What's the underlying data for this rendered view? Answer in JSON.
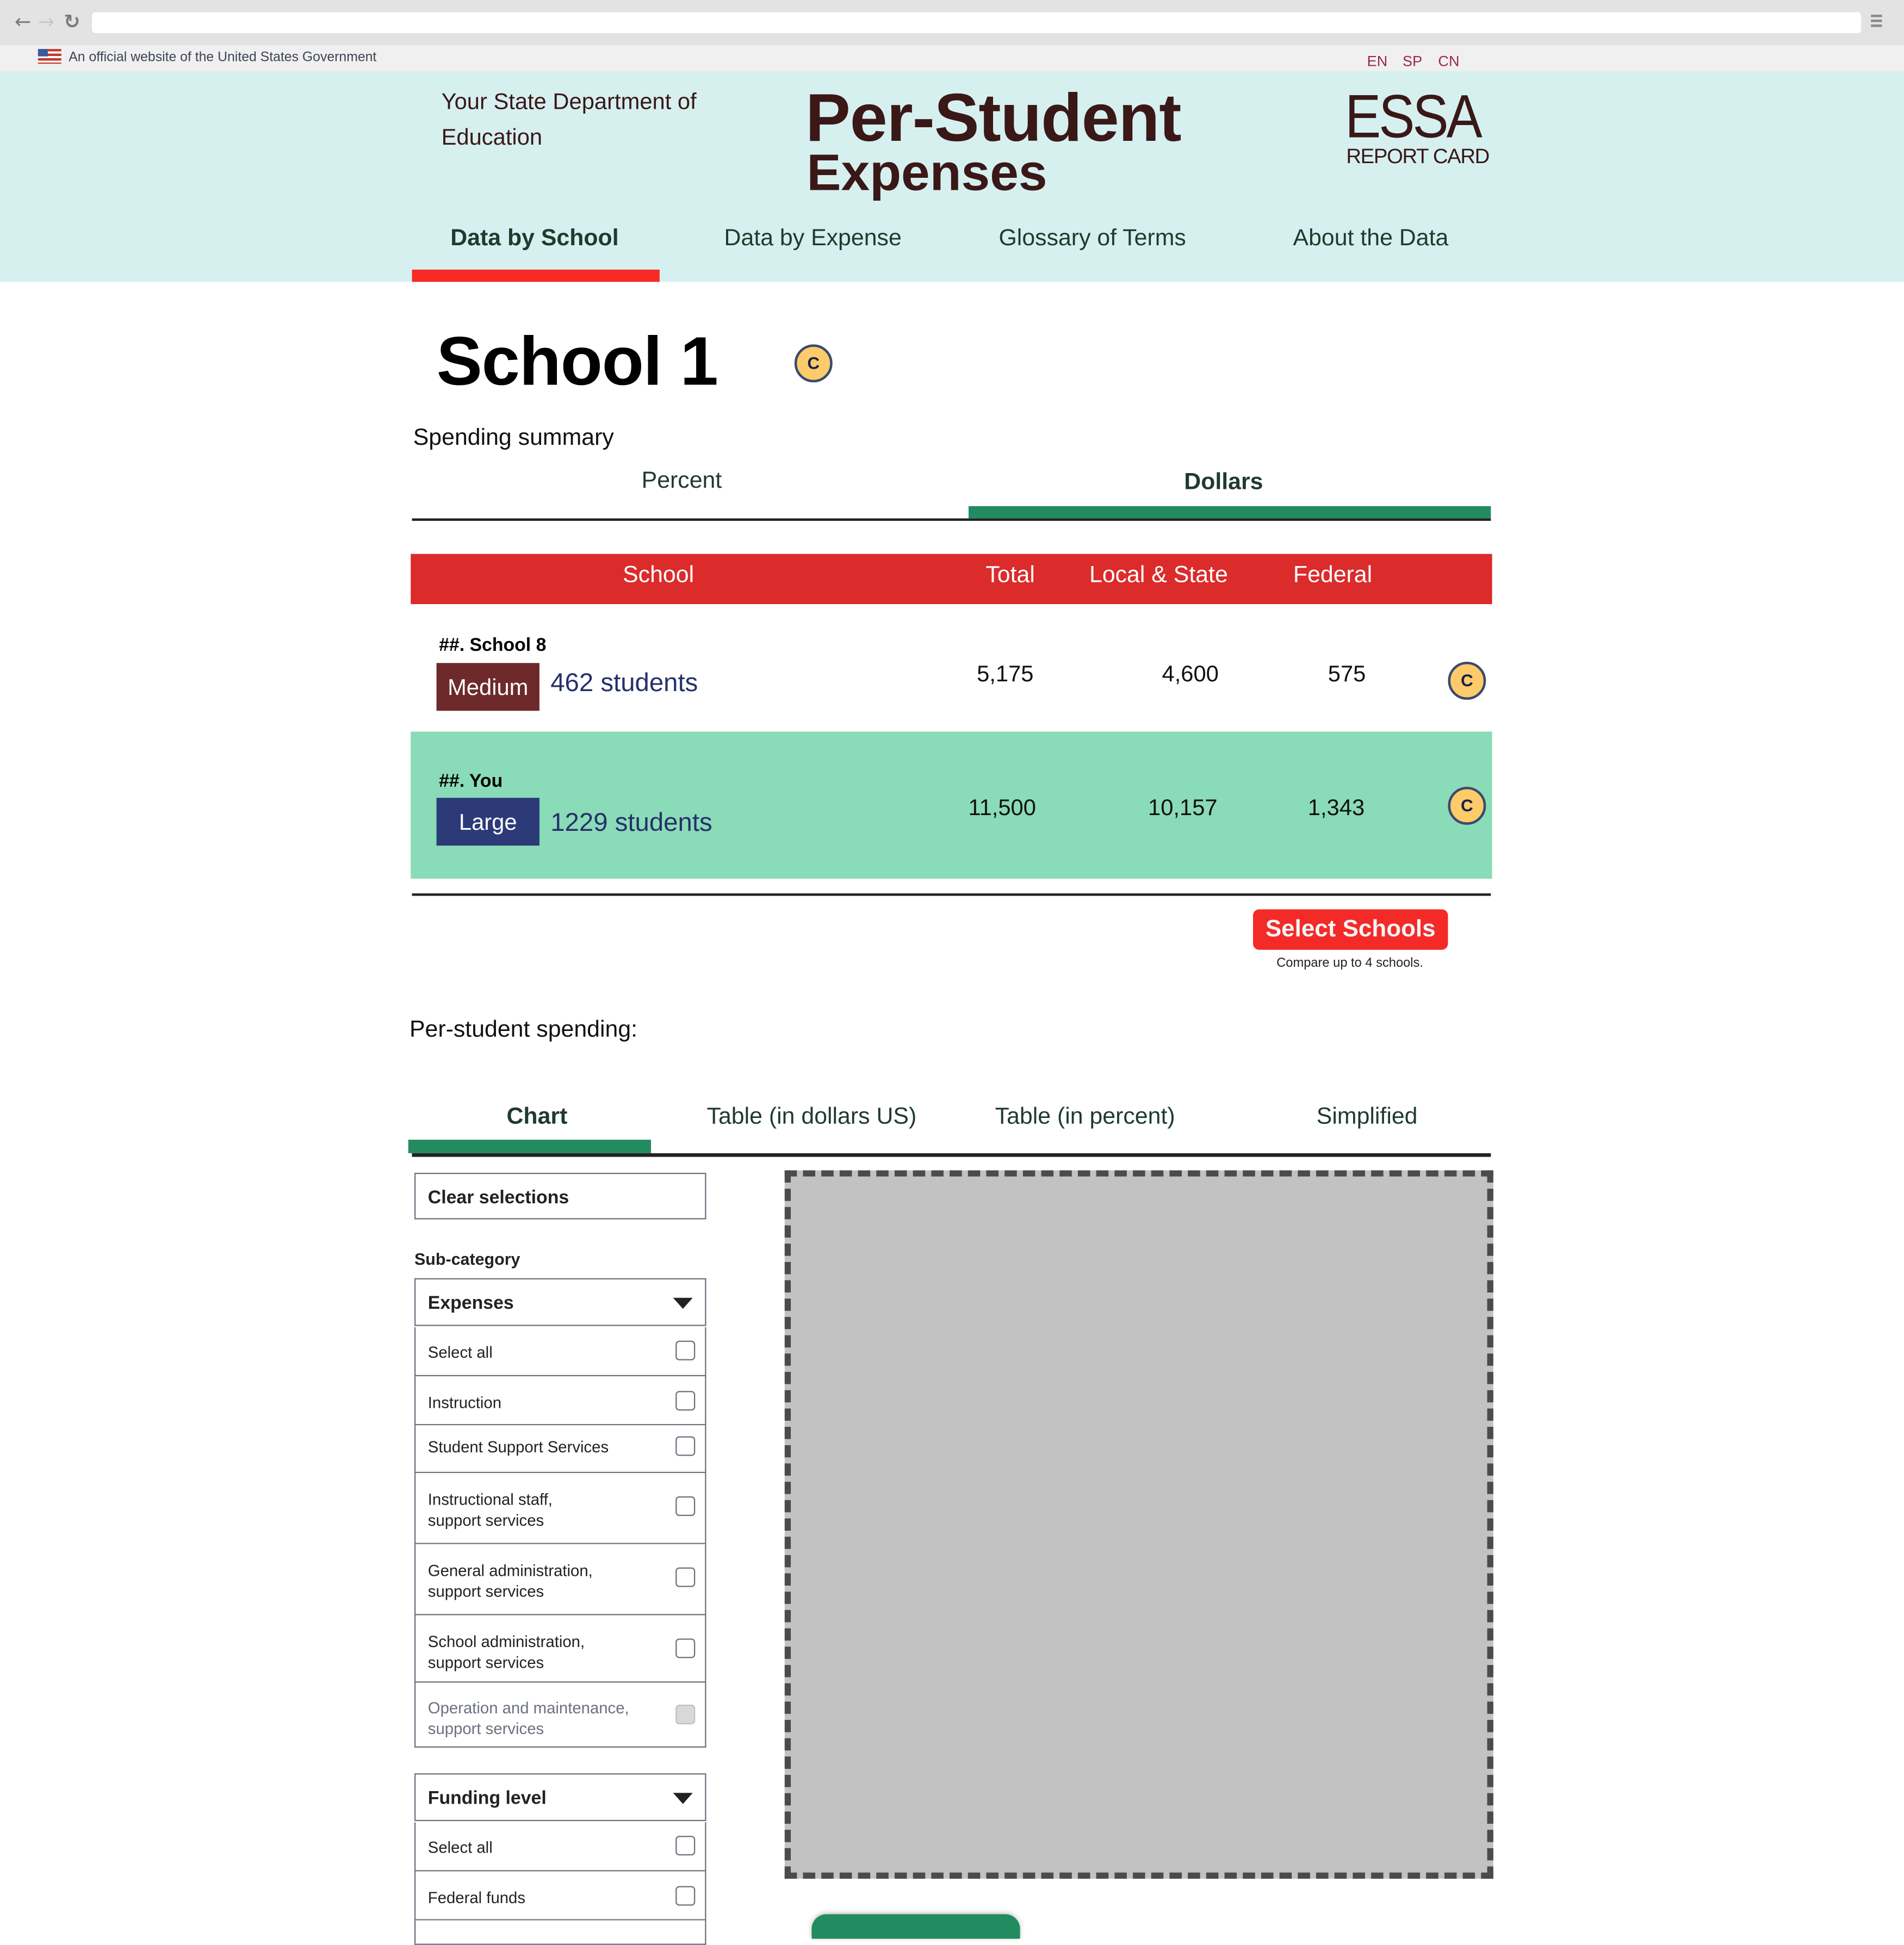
{
  "browser": {
    "back_icon": "arrow-left-icon",
    "forward_icon": "arrow-right-icon",
    "reload_icon": "reload-icon",
    "address": "",
    "menu_icon": "hamburger-menu-icon"
  },
  "gov_banner": {
    "flag_icon": "us-flag-icon",
    "text": "An official website of the United States Government",
    "languages": [
      "EN",
      "SP",
      "CN"
    ]
  },
  "header": {
    "department": "Your State Department of Education",
    "title_line1": "Per-Student",
    "title_line2": "Expenses",
    "logo_main": "ESSA",
    "logo_sub": "REPORT CARD",
    "nav": [
      {
        "label": "Data by School",
        "active": true
      },
      {
        "label": "Data by Expense",
        "active": false
      },
      {
        "label": "Glossary of Terms",
        "active": false
      },
      {
        "label": "About the Data",
        "active": false
      }
    ],
    "colors": {
      "background": "#d6f0ef",
      "active_underline": "#f72a25",
      "title": "#3a1818"
    }
  },
  "school": {
    "name": "School 1",
    "badge": "C"
  },
  "spending_summary": {
    "label": "Spending summary",
    "tabs": [
      {
        "label": "Percent",
        "active": false
      },
      {
        "label": "Dollars",
        "active": true
      }
    ],
    "columns": [
      "School",
      "Total",
      "Local & State",
      "Federal"
    ],
    "rows": [
      {
        "name": "##. School 8",
        "size": "Medium",
        "size_color": "#6e2a2b",
        "students": "462 students",
        "total": "5,175",
        "local_state": "4,600",
        "federal": "575",
        "badge": "C",
        "highlighted": false
      },
      {
        "name": "##. You",
        "size": "Large",
        "size_color": "#2d3a78",
        "students": "1229 students",
        "total": "11,500",
        "local_state": "10,157",
        "federal": "1,343",
        "badge": "C",
        "highlighted": true
      }
    ],
    "select_button": "Select Schools",
    "select_hint": "Compare up to 4 schools.",
    "colors": {
      "header": "#db2b2b",
      "highlight_row": "#8adbb7",
      "active_tab": "#228b60",
      "button": "#f42a28"
    }
  },
  "per_student": {
    "label": "Per-student spending:",
    "tabs": [
      {
        "label": "Chart",
        "active": true
      },
      {
        "label": "Table (in dollars US)",
        "active": false
      },
      {
        "label": "Table (in percent)",
        "active": false
      },
      {
        "label": "Simplified",
        "active": false
      }
    ],
    "clear_label": "Clear selections",
    "subcategory_label": "Sub-category",
    "expenses_dropdown": {
      "label": "Expenses",
      "options": [
        {
          "label": "Select all",
          "checked": false,
          "disabled": false
        },
        {
          "label": "Instruction",
          "checked": false,
          "disabled": false
        },
        {
          "label": "Student Support Services",
          "checked": false,
          "disabled": false
        },
        {
          "label": "Instructional staff,\nsupport services",
          "checked": false,
          "disabled": false
        },
        {
          "label": "General administration,\nsupport services",
          "checked": false,
          "disabled": false
        },
        {
          "label": "School administration,\nsupport services",
          "checked": false,
          "disabled": false
        },
        {
          "label": "Operation and maintenance,\nsupport services",
          "checked": false,
          "disabled": true
        }
      ]
    },
    "funding_dropdown": {
      "label": "Funding level",
      "options": [
        {
          "label": "Select all",
          "checked": false,
          "disabled": false
        },
        {
          "label": "Federal funds",
          "checked": false,
          "disabled": false
        }
      ]
    },
    "chart_placeholder": "chart-placeholder"
  }
}
